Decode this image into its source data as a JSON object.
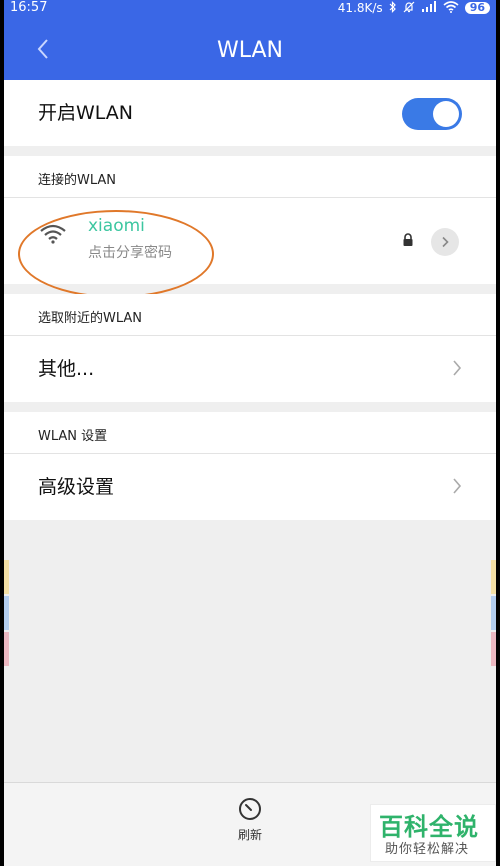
{
  "status_bar": {
    "time": "16:57",
    "speed": "41.8K/s",
    "battery": "96"
  },
  "header": {
    "title": "WLAN",
    "back_icon": "chevron-left-icon"
  },
  "wlan_toggle": {
    "label": "开启WLAN",
    "state": "on",
    "accent": "#3a7ae6"
  },
  "connected": {
    "section_title": "连接的WLAN",
    "network": {
      "ssid": "xiaomi",
      "subtitle": "点击分享密码",
      "secured": true
    }
  },
  "nearby": {
    "section_title": "选取附近的WLAN",
    "item_label": "其他..."
  },
  "settings": {
    "section_title": "WLAN 设置",
    "item_label": "高级设置"
  },
  "bottom": {
    "refresh_label": "刷新"
  },
  "watermark": {
    "title": "百科全说",
    "subtitle": "助你轻松解决"
  },
  "colors": {
    "brand": "#3a67e6",
    "ssid": "#3cc6a0",
    "annotation": "#e0782a"
  }
}
